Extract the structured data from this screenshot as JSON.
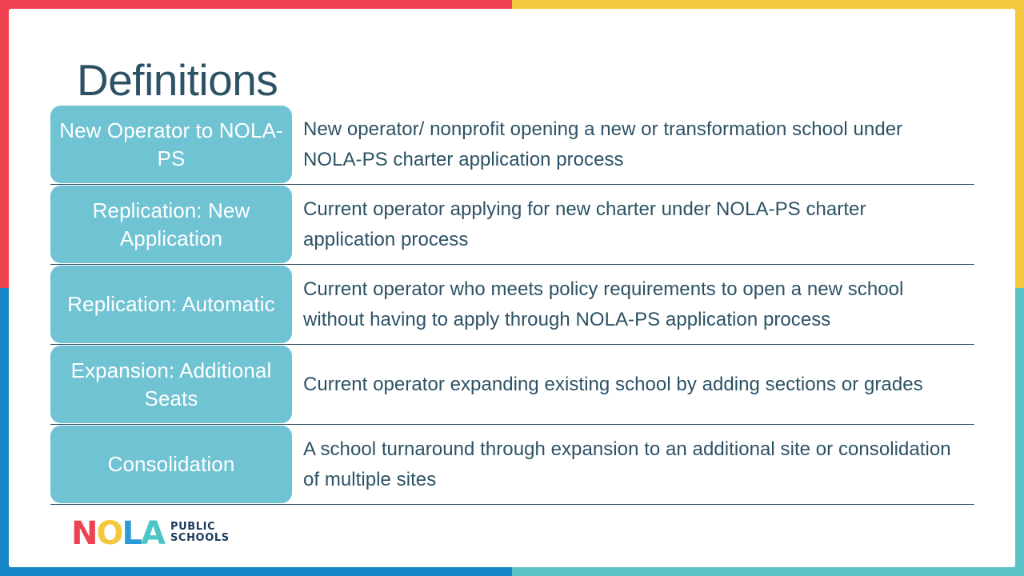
{
  "slide": {
    "title": "Definitions",
    "colors": {
      "border_top_left": "#EF4250",
      "border_top_right": "#F5C73C",
      "border_bottom_left": "#1586C8",
      "border_bottom_right": "#5BC4C9",
      "border_left_top": "#EF4250",
      "border_left_bottom": "#1586C8",
      "border_right_top": "#F5C73C",
      "border_right_bottom": "#5BC4C9",
      "term_box": "#6FC3D2",
      "text": "#2C5265",
      "term_text": "#FFFFFF"
    }
  },
  "definitions": [
    {
      "term": "New Operator to NOLA-PS",
      "description": "New operator/ nonprofit opening a new or transformation school under NOLA-PS charter application process"
    },
    {
      "term": "Replication: New Application",
      "description": "Current operator applying for new charter under NOLA-PS charter application process"
    },
    {
      "term": "Replication: Automatic",
      "description": "Current operator who meets policy requirements to open a new school without having to apply through NOLA-PS application process"
    },
    {
      "term": "Expansion: Additional Seats",
      "description": "Current operator expanding existing school by adding sections or grades"
    },
    {
      "term": "Consolidation",
      "description": "A school turnaround through expansion to an additional site or consolidation of multiple sites"
    }
  ],
  "logo": {
    "letter_n": "N",
    "letter_o": "O",
    "letter_l": "L",
    "letter_a": "A",
    "word_line1": "PUBLIC",
    "word_line2": "SCHOOLS"
  }
}
